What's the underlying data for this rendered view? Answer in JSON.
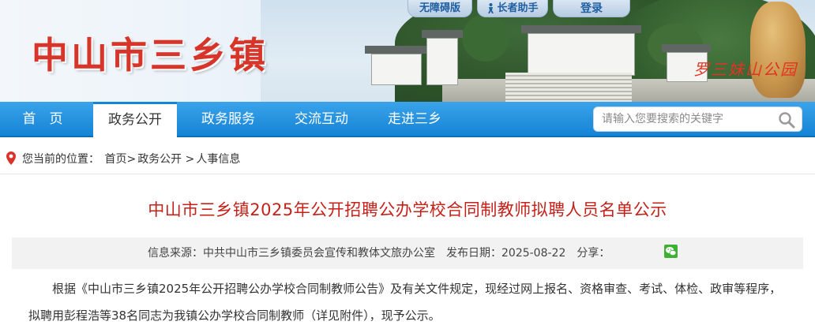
{
  "site": {
    "title": "中山市三乡镇",
    "banner_caption": "罗三妹山公园"
  },
  "top_links": {
    "accessible": "无障碍版",
    "elder": "长者助手",
    "login": "登录"
  },
  "nav": {
    "items": [
      {
        "label": "首　页"
      },
      {
        "label": "政务公开"
      },
      {
        "label": "政务服务"
      },
      {
        "label": "交流互动"
      },
      {
        "label": "走进三乡"
      }
    ],
    "active_index": 1
  },
  "search": {
    "placeholder": "请输入您要搜索的关键字"
  },
  "breadcrumb": {
    "prefix": "您当前的位置：",
    "items": [
      "首页",
      "政务公开",
      "人事信息"
    ],
    "sep": ">"
  },
  "article": {
    "title": "中山市三乡镇2025年公开招聘公办学校合同制教师拟聘人员名单公示",
    "source_label": "信息来源：",
    "source": "中共中山市三乡镇委员会宣传和教体文旅办公室",
    "date_label": "发布日期：",
    "date": "2025-08-22",
    "share_label": "分享：",
    "body": "根据《中山市三乡镇2025年公开招聘公办学校合同制教师公告》及有关文件规定，现经过网上报名、资格审查、考试、体检、政审等程序，拟聘用彭程浩等38名同志为我镇公办学校合同制教师（详见附件），现予公示。"
  },
  "colors": {
    "nav_blue": "#1584d6",
    "title_red": "#c4221a",
    "site_title_red": "#d7342a",
    "wechat_green": "#3eb135"
  },
  "icons": [
    "elder-helper-icon",
    "search-icon",
    "location-pin-icon",
    "wechat-icon"
  ]
}
